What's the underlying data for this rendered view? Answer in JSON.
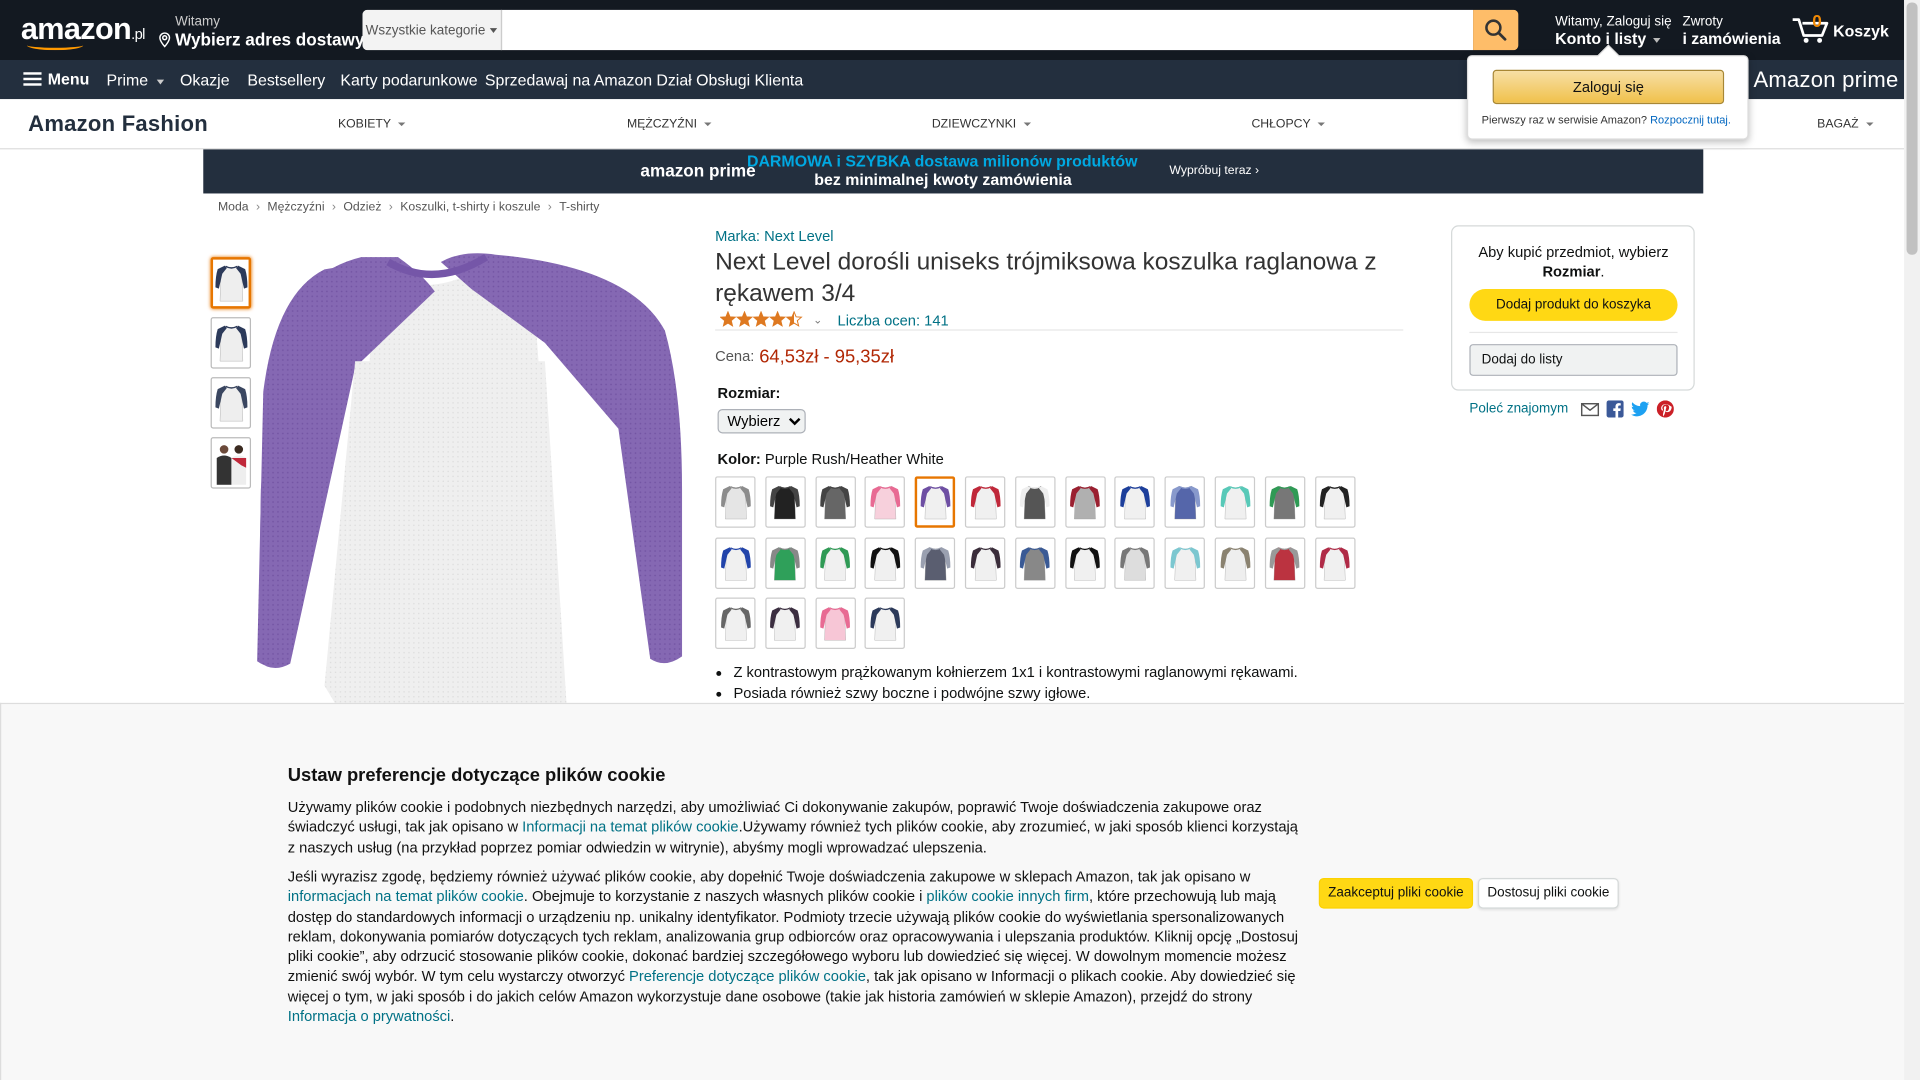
{
  "header": {
    "logo_text": "amazon",
    "logo_tld": ".pl",
    "deliver_line1": "Witamy",
    "deliver_line2": "Wybierz adres dostawy",
    "search_category": "Wszystkie kategorie",
    "search_placeholder": "",
    "account_line1": "Witamy, Zaloguj się",
    "account_line2": "Konto i listy",
    "returns_line1": "Zwroty",
    "returns_line2": "i zamówienia",
    "cart_count": "0",
    "cart_label": "Koszyk"
  },
  "belt": {
    "menu": "Menu",
    "items": [
      "Prime",
      "Okazje",
      "Bestsellery",
      "Karty podarunkowe",
      "Sprzedawaj na Amazon",
      "Dział Obsługi Klienta"
    ],
    "prime_logo": "Amazon prime"
  },
  "flyout": {
    "signin": "Zaloguj się",
    "new_customer": "Pierwszy raz w serwisie Amazon?",
    "start_link": "Rozpocznij tutaj."
  },
  "subnav": {
    "brand": "Amazon Fashion",
    "items": [
      "KOBIETY",
      "MĘŻCZYŹNI",
      "DZIEWCZYNKI",
      "CHŁOPCY",
      "BAGAŻ"
    ]
  },
  "banner": {
    "prime": "amazon prime",
    "line1": "DARMOWA i SZYBKA dostawa milionów produktów",
    "line2": "bez minimalnej kwoty zamówienia",
    "cta": "Wypróbuj teraz ›"
  },
  "breadcrumb": [
    "Moda",
    "Mężczyźni",
    "Odzież",
    "Koszulki, t-shirty i koszule",
    "T-shirty"
  ],
  "product": {
    "brand": "Marka: Next Level",
    "title": "Next Level dorośli uniseks trójmiksowa koszulka raglanowa z rękawem 3/4",
    "rating": 4.5,
    "ratings_count": "Liczba ocen: 141",
    "price_label": "Cena:",
    "price": "64,53zł - 95,35zł",
    "size_label": "Rozmiar:",
    "size_selected": "Wybierz",
    "color_label": "Kolor:",
    "color_value": "Purple Rush/Heather White",
    "bullets": [
      "Z kontrastowym prążkowanym kołnierzem 1x1 i kontrastowymi raglanowymi rękawami.",
      "Posiada również szwy boczne i podwójne szwy igłowe."
    ]
  },
  "thumbnails": [
    {
      "body": "#eeeeee",
      "sleeve": "#2c3a5a",
      "person": false
    },
    {
      "body": "#eeeeee",
      "sleeve": "#2c3a5a",
      "person": false
    },
    {
      "body": "#eeeeee",
      "sleeve": "#3a4660",
      "person": false
    },
    {
      "body": "#333333",
      "sleeve": "#222222",
      "person": true
    }
  ],
  "swatches": [
    {
      "body": "#e5e5e5",
      "sleeve": "#8c8c8c"
    },
    {
      "body": "#222222",
      "sleeve": "#444444"
    },
    {
      "body": "#666666",
      "sleeve": "#444444"
    },
    {
      "body": "#f7d0dc",
      "sleeve": "#e86a93"
    },
    {
      "body": "#f0f0f0",
      "sleeve": "#6e4fa3"
    },
    {
      "body": "#f0f0f0",
      "sleeve": "#c0283a"
    },
    {
      "body": "#555555",
      "sleeve": "#eeeeee"
    },
    {
      "body": "#b0b0b0",
      "sleeve": "#9a2030"
    },
    {
      "body": "#f0f0f0",
      "sleeve": "#1d3f9b"
    },
    {
      "body": "#5566aa",
      "sleeve": "#8899cc"
    },
    {
      "body": "#f0f0f0",
      "sleeve": "#58c9b8"
    },
    {
      "body": "#777777",
      "sleeve": "#2f9a55"
    },
    {
      "body": "#f0f0f0",
      "sleeve": "#222222"
    },
    {
      "body": "#f0f0f0",
      "sleeve": "#2244aa"
    },
    {
      "body": "#2fa05a",
      "sleeve": "#888888"
    },
    {
      "body": "#f0f0f0",
      "sleeve": "#2f9a55"
    },
    {
      "body": "#f0f0f0",
      "sleeve": "#111111"
    },
    {
      "body": "#5a5e70",
      "sleeve": "#9aa0b0"
    },
    {
      "body": "#f0f0f0",
      "sleeve": "#3a2d3a"
    },
    {
      "body": "#888888",
      "sleeve": "#3a5a95"
    },
    {
      "body": "#f0f0f0",
      "sleeve": "#111111"
    },
    {
      "body": "#dddddd",
      "sleeve": "#777777"
    },
    {
      "body": "#f0f0f0",
      "sleeve": "#7cc7d0"
    },
    {
      "body": "#eeeeee",
      "sleeve": "#8a8270"
    },
    {
      "body": "#bb3340",
      "sleeve": "#999999"
    },
    {
      "body": "#f0f0f0",
      "sleeve": "#b02b47"
    },
    {
      "body": "#f0f0f0",
      "sleeve": "#666666"
    },
    {
      "body": "#f0f0f0",
      "sleeve": "#3b2e40"
    },
    {
      "body": "#f7c6d6",
      "sleeve": "#e86a93"
    },
    {
      "body": "#f0f0f0",
      "sleeve": "#2c3a5a"
    }
  ],
  "selected_swatch": 4,
  "buybox": {
    "msg_prefix": "Aby kupić przedmiot, wybierz",
    "msg_bold": "Rozmiar",
    "msg_suffix": ".",
    "add_to_cart": "Dodaj produkt do koszyka",
    "add_to_list": "Dodaj do listy"
  },
  "share": {
    "label": "Poleć znajomym"
  },
  "cookie": {
    "title": "Ustaw preferencje dotyczące plików cookie",
    "p1_a": "Używamy plików cookie i podobnych niezbędnych narzędzi, aby umożliwiać Ci dokonywanie zakupów, poprawić Twoje doświadczenia zakupowe oraz świadczyć usługi, tak jak opisano w ",
    "p1_link": "Informacji na temat plików cookie",
    "p1_b": ".Używamy również tych plików cookie, aby zrozumieć, w jaki sposób klienci korzystają z naszych usług (na przykład poprzez pomiar odwiedzin w witrynie), abyśmy mogli wprowadzać ulepszenia.",
    "p2_a": "Jeśli wyrazisz zgodę, będziemy również używać plików cookie, aby dopełnić Twoje doświadczenia zakupowe w sklepach Amazon, tak jak opisano w ",
    "p2_link1": "informacjach na temat plików cookie",
    "p2_b": ". Obejmuje to korzystanie z naszych własnych plików cookie i ",
    "p2_link2": "plików cookie innych firm",
    "p2_c": ", które przechowują lub mają dostęp do standardowych informacji o urządzeniu np. unikalny identyfikator. Podmioty trzecie używają plików cookie do wyświetlania spersonalizowanych reklam, dokonywania pomiarów dotyczących tych reklam, analizowania grup odbiorców oraz opracowywania i ulepszania produktów. Kliknij opcję „Dostosuj pliki cookie”, aby odrzucić stosowanie plików cookie, dokonać bardziej szczegółowego wyboru lub dowiedzieć się więcej. W dowolnym momencie możesz zmienić swój wybór. W tym celu wystarczy otworzyć ",
    "p2_link3": "Preferencje dotyczące plików cookie",
    "p2_d": ", tak jak opisano w Informacji o plikach cookie. Aby dowiedzieć się więcej o tym, w jaki sposób i do jakich celów Amazon wykorzystuje dane osobowe (takie jak historia zamówień w sklepie Amazon), przejdź do strony ",
    "p2_link4": "Informacja o prywatności",
    "p2_e": ".",
    "accept": "Zaakceptuj pliki cookie",
    "customize": "Dostosuj pliki cookie"
  },
  "colors": {
    "header_bg": "#131921",
    "belt_bg": "#232f3e",
    "accent": "#ff9900",
    "link": "#007185",
    "price": "#b12704",
    "button_yellow": "#ffd814"
  }
}
